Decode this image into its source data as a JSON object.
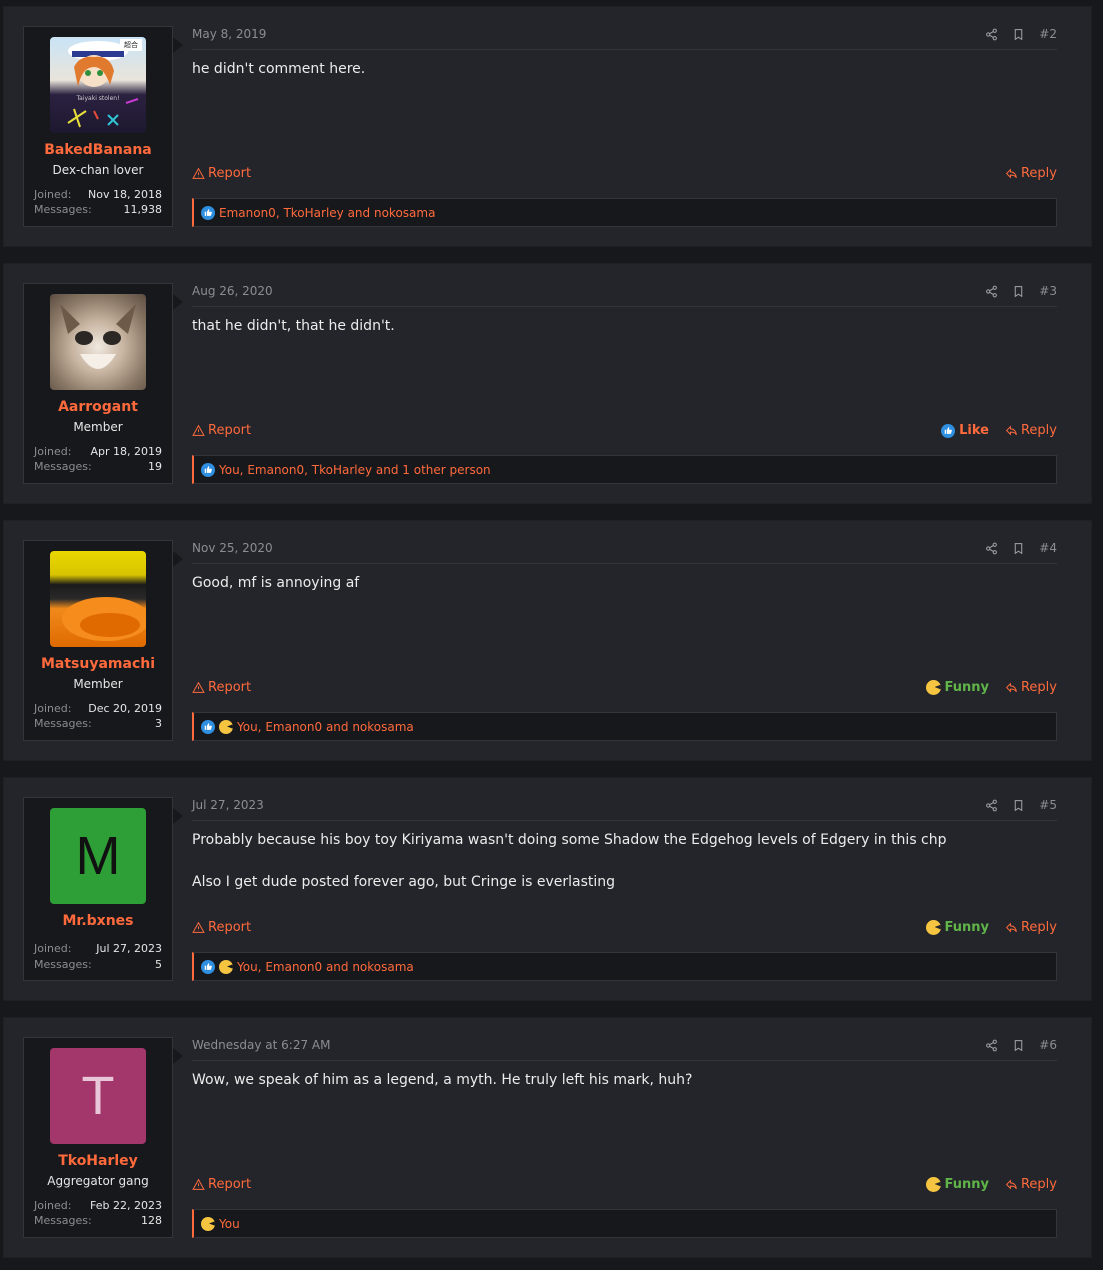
{
  "labels": {
    "joined": "Joined:",
    "messages": "Messages:",
    "report": "Report",
    "reply": "Reply",
    "like": "Like",
    "funny": "Funny"
  },
  "colors": {
    "accent": "#ff6a3d",
    "funny": "#5fb548",
    "like": "#2f8fe0"
  },
  "posts": [
    {
      "username": "BakedBanana",
      "user_title": "Dex-chan lover",
      "joined": "Nov 18, 2018",
      "messages": "11,938",
      "date": "May 8, 2019",
      "number": "#2",
      "content": [
        "he didn't comment here."
      ],
      "reactions": "Emanon0, TkoHarley and nokosama",
      "avatar_caption": "Taiyaki stolen!",
      "avatar_badge": "超合"
    },
    {
      "username": "Aarrogant",
      "user_title": "Member",
      "joined": "Apr 18, 2019",
      "messages": "19",
      "date": "Aug 26, 2020",
      "number": "#3",
      "content": [
        "that he didn't, that he didn't."
      ],
      "reactions": "You, Emanon0, TkoHarley and 1 other person"
    },
    {
      "username": "Matsuyamachi",
      "user_title": "Member",
      "joined": "Dec 20, 2019",
      "messages": "3",
      "date": "Nov 25, 2020",
      "number": "#4",
      "content": [
        "Good, mf is annoying af"
      ],
      "reactions": "You, Emanon0 and nokosama"
    },
    {
      "username": "Mr.bxnes",
      "user_title": "",
      "avatar_letter": "M",
      "avatar_color": "#2e9e36",
      "joined": "Jul 27, 2023",
      "messages": "5",
      "date": "Jul 27, 2023",
      "number": "#5",
      "content": [
        "Probably because his boy toy Kiriyama wasn't doing some Shadow the Edgehog levels of Edgery in this chp",
        "Also I get dude posted forever ago, but Cringe is everlasting"
      ],
      "reactions": "You, Emanon0 and nokosama"
    },
    {
      "username": "TkoHarley",
      "user_title": "Aggregator gang",
      "avatar_letter": "T",
      "avatar_color": "#a3366a",
      "joined": "Feb 22, 2023",
      "messages": "128",
      "date": "Wednesday at 6:27 AM",
      "number": "#6",
      "content": [
        "Wow, we speak of him as a legend, a myth. He truly left his mark, huh?"
      ],
      "reactions": "You"
    }
  ]
}
